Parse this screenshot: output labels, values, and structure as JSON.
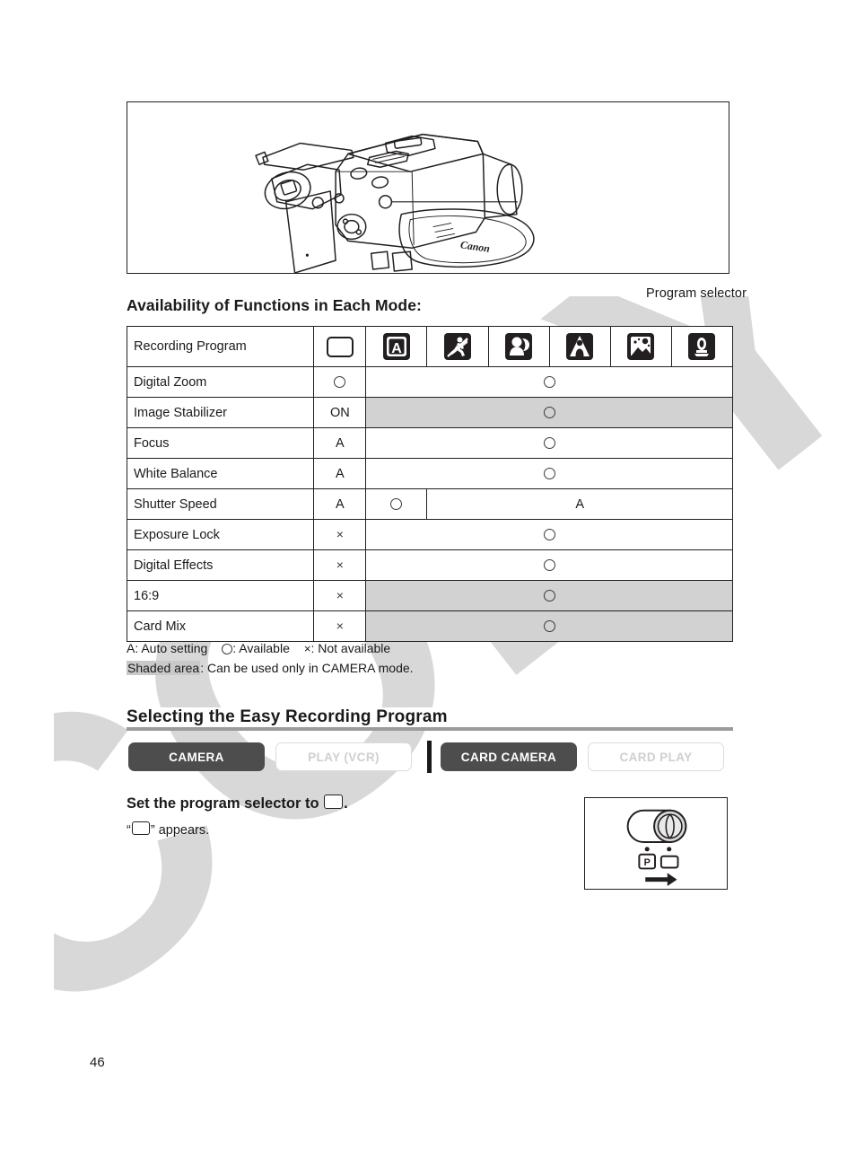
{
  "page": {
    "number": "46",
    "watermark": "COPY",
    "watermark_color": "#d8d8d8"
  },
  "illustration": {
    "caption": "Program selector",
    "device": "camcorder-side-view"
  },
  "availability": {
    "title": "Availability of Functions in Each Mode:",
    "header_label": "Recording Program",
    "mode_icons": [
      {
        "name": "easy-recording-icon",
        "label": "Easy Recording"
      },
      {
        "name": "auto-icon",
        "label": "Auto"
      },
      {
        "name": "sports-icon",
        "label": "Sports"
      },
      {
        "name": "portrait-icon",
        "label": "Portrait"
      },
      {
        "name": "spotlight-icon",
        "label": "Spotlight"
      },
      {
        "name": "sand-and-snow-icon",
        "label": "Sand & Snow"
      },
      {
        "name": "low-light-icon",
        "label": "Low Light"
      }
    ],
    "rows": [
      {
        "function": "Digital Zoom",
        "easy": "o",
        "rest": "o",
        "shaded": false
      },
      {
        "function": "Image Stabilizer",
        "easy": "ON",
        "rest": "o",
        "shaded": true
      },
      {
        "function": "Focus",
        "easy": "A",
        "rest": "o",
        "shaded": false
      },
      {
        "function": "White Balance",
        "easy": "A",
        "rest": "o",
        "shaded": false
      },
      {
        "function": "Shutter Speed",
        "easy": "A",
        "auto": "o",
        "rest": "A",
        "split": true,
        "shaded": false
      },
      {
        "function": "Exposure Lock",
        "easy": "x",
        "rest": "o",
        "shaded": false
      },
      {
        "function": "Digital Effects",
        "easy": "x",
        "rest": "o",
        "shaded": false
      },
      {
        "function": "16:9",
        "easy": "x",
        "rest": "o",
        "shaded": true
      },
      {
        "function": "Card Mix",
        "easy": "x",
        "rest": "o",
        "shaded": true
      }
    ],
    "legend": {
      "auto": "A: Auto setting",
      "available": ": Available",
      "not_available": ": Not available",
      "x_symbol": "×",
      "shaded_chip": "Shaded area",
      "shaded_text": ": Can be used only in CAMERA mode."
    }
  },
  "section": {
    "heading": "Selecting the Easy Recording Program",
    "modes": [
      {
        "label": "CAMERA",
        "state": "on"
      },
      {
        "label": "PLAY (VCR)",
        "state": "off"
      },
      {
        "label": "CARD CAMERA",
        "state": "on"
      },
      {
        "label": "CARD PLAY",
        "state": "off"
      }
    ],
    "step_before": "Set the program selector to",
    "step_after": ".",
    "sub_before": "“",
    "sub_after": "” appears."
  },
  "dial_diagram": {
    "position_p": "P",
    "position_easy": "easy-recording-icon",
    "arrow": "arrow-right-icon"
  }
}
